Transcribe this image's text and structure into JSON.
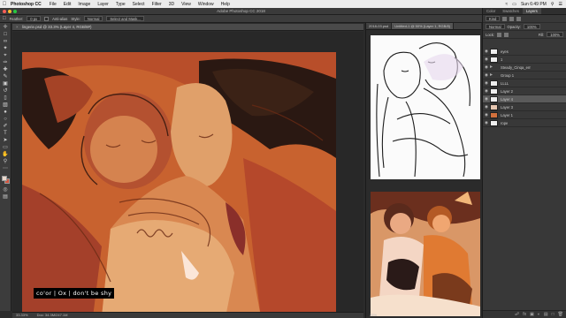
{
  "menubar": {
    "app": "Photoshop CC",
    "items": [
      "File",
      "Edit",
      "Image",
      "Layer",
      "Type",
      "Select",
      "Filter",
      "3D",
      "View",
      "Window",
      "Help"
    ],
    "clock": "Sun 6:49 PM"
  },
  "window": {
    "title": "Adobe Photoshop CC 2018"
  },
  "options": {
    "feather_label": "Feather:",
    "feather_value": "0 px",
    "antialias_label": "Anti-alias",
    "style_label": "Style:",
    "style_value": "Normal",
    "select_mask": "Select and Mask..."
  },
  "document": {
    "tab": "lingerie.psd @ 33.3% (Layer 4, RGB/8#)",
    "zoom": "33.33%",
    "doc_size": "Doc: 34.3M/247.1M"
  },
  "caption": "co'or | Ox | don't be shy",
  "doc2": {
    "tabs": [
      "2018-03.psd",
      "Untitled-1 @ 50% (Layer 1, RGB/8)"
    ],
    "zoom": "25%"
  },
  "panels": {
    "tabs": [
      "Color",
      "Swatches",
      "Layers"
    ],
    "kind": "Kind",
    "blend": "Normal",
    "opacity_label": "Opacity:",
    "opacity_value": "100%",
    "lock_label": "Lock:",
    "fill_label": "Fill:",
    "fill_value": "100%",
    "layers": [
      {
        "name": "eyes",
        "type": "layer",
        "selected": false
      },
      {
        "name": "1",
        "type": "layer",
        "selected": false
      },
      {
        "name": "Steady_Cinqa_em",
        "type": "folder",
        "selected": false
      },
      {
        "name": "Group 1",
        "type": "folder",
        "selected": false
      },
      {
        "name": "LLLL",
        "type": "layer",
        "selected": false
      },
      {
        "name": "Layer 2",
        "type": "layer",
        "selected": false
      },
      {
        "name": "Layer 4",
        "type": "layer",
        "selected": true
      },
      {
        "name": "Layer 3",
        "type": "layer",
        "selected": false
      },
      {
        "name": "Layer 1",
        "type": "layer",
        "selected": false
      },
      {
        "name": "rope",
        "type": "layer",
        "selected": false
      }
    ]
  },
  "colors": {
    "fg": "#e9d8cc",
    "bg": "#d2553f",
    "accent": "#5a5a5a"
  }
}
